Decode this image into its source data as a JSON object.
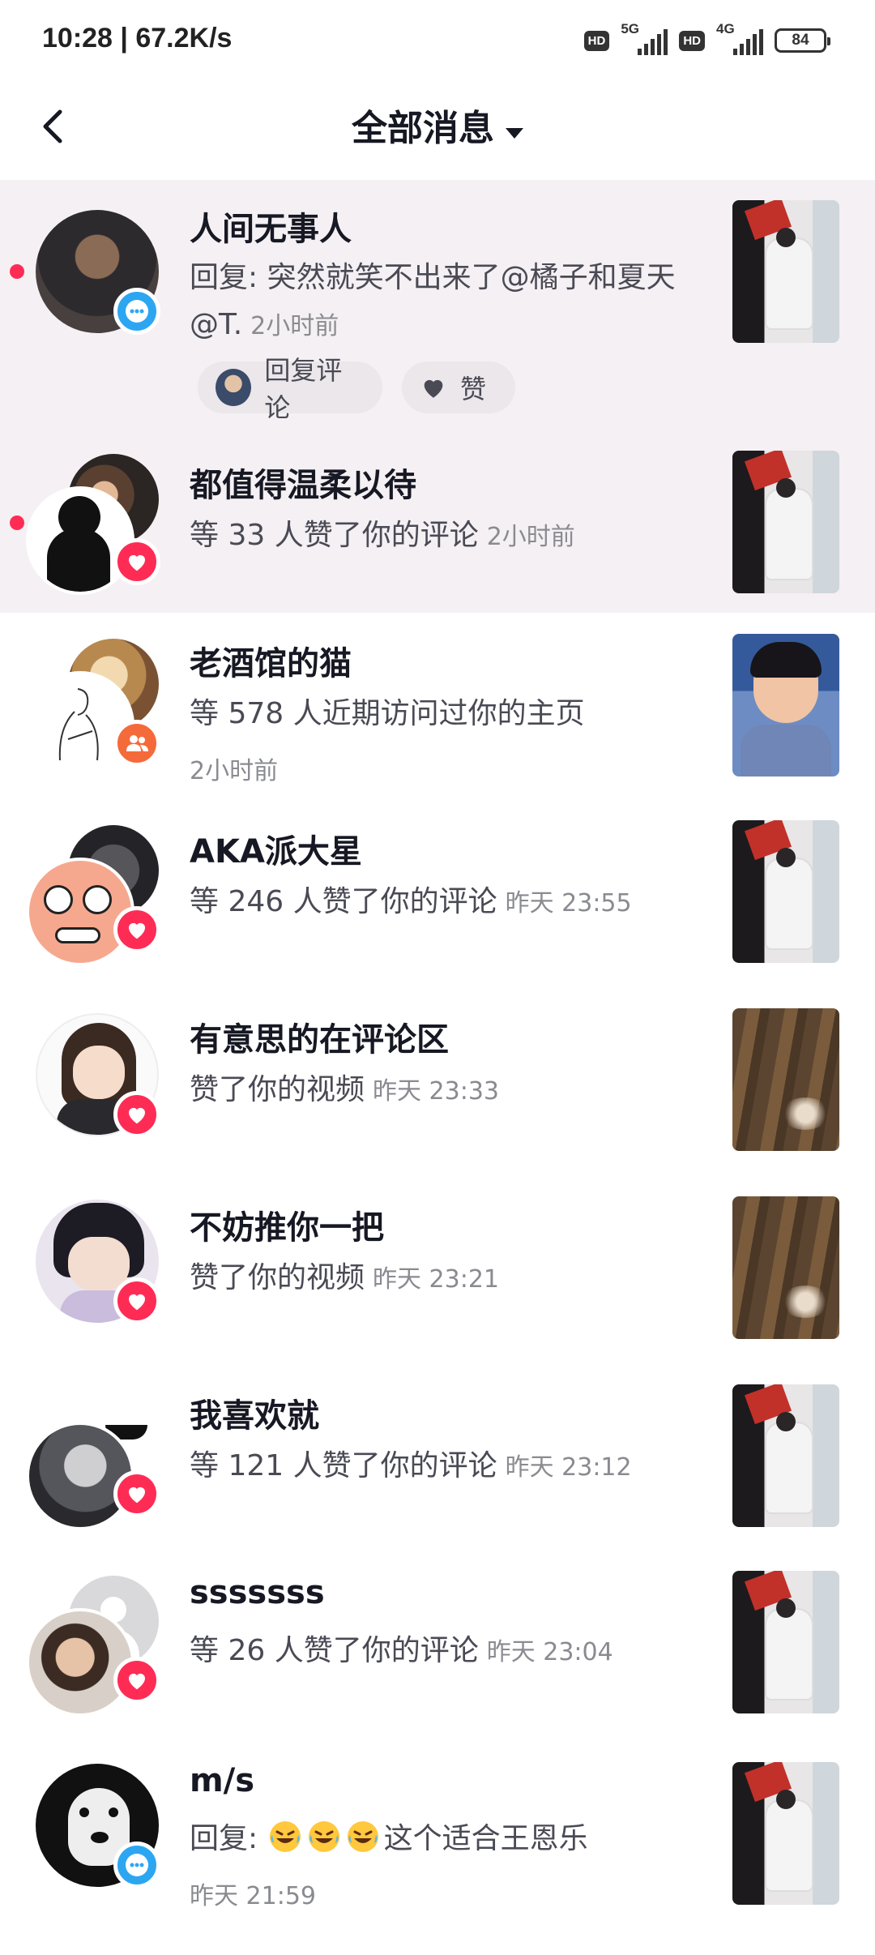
{
  "status_bar": {
    "time_speed": "10:28 | 67.2K/s",
    "hd1": "HD",
    "net1": "5G",
    "hd2": "HD",
    "net2": "4G",
    "battery": "84"
  },
  "header": {
    "title": "全部消息"
  },
  "notifications": [
    {
      "name": "人间无事人",
      "text": "回复: 突然就笑不出来了@橘子和夏天 @T.",
      "time": "2小时前",
      "type": "reply",
      "unread": true,
      "reply_label": "回复评论",
      "like_label": "赞"
    },
    {
      "name": "都值得温柔以待",
      "text": "等 33 人赞了你的评论",
      "time": "2小时前",
      "type": "like",
      "unread": true
    },
    {
      "name": "老酒馆的猫",
      "text": "等 578 人近期访问过你的主页",
      "time": "2小时前",
      "type": "visit",
      "unread": false
    },
    {
      "name": "AKA派大星",
      "text": "等 246 人赞了你的评论",
      "time": "昨天 23:55",
      "type": "like",
      "unread": false
    },
    {
      "name": "有意思的在评论区",
      "text": "赞了你的视频",
      "time": "昨天 23:33",
      "type": "like",
      "unread": false
    },
    {
      "name": "不妨推你一把",
      "text": "赞了你的视频",
      "time": "昨天 23:21",
      "type": "like",
      "unread": false
    },
    {
      "name": "我喜欢就",
      "text": "等 121 人赞了你的评论",
      "time": "昨天 23:12",
      "type": "like",
      "unread": false
    },
    {
      "name": "sssssss",
      "text": "等 26 人赞了你的评论",
      "time": "昨天 23:04",
      "type": "like",
      "unread": false
    },
    {
      "name": "m/s",
      "text_prefix": "回复:",
      "text_suffix": "这个适合王恩乐",
      "emoji": "laughing-tears-emoji",
      "emoji_count": 3,
      "time": "昨天 21:59",
      "type": "reply",
      "unread": false
    }
  ],
  "colors": {
    "accent": "#fe2c55",
    "comment_badge": "#2da6f2",
    "visit_badge": "#f56a3a",
    "unread_bg": "#f5f0f3"
  }
}
